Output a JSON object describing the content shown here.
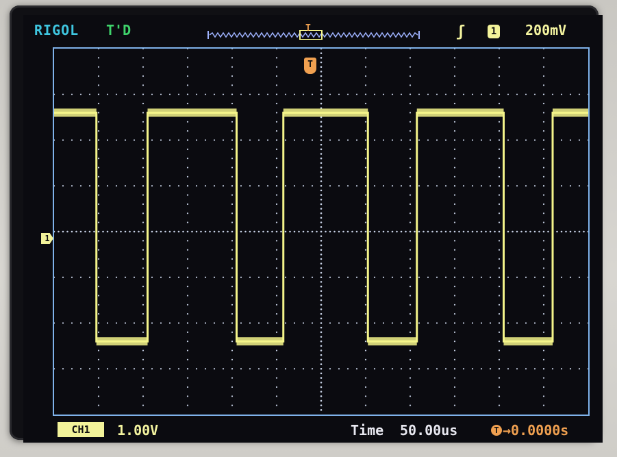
{
  "header": {
    "brand": "RIGOL",
    "trigger_status": "T'D",
    "trigger_marker": "T",
    "trigger_slope_icon": "rising-edge-icon",
    "trigger_source": "1",
    "trigger_level": "200mV"
  },
  "grid": {
    "h_div": 12,
    "v_div": 8
  },
  "waveform": {
    "color": "#f4f48a",
    "levels": {
      "high_div": 2.6,
      "low_div": -2.4
    },
    "transitions_div": [
      0.95,
      2.1,
      4.1,
      5.15,
      7.05,
      8.15,
      10.1,
      11.2
    ]
  },
  "markers": {
    "ch1_ground": "1",
    "trigger_position": "T"
  },
  "footer": {
    "ch1_label": "CH1",
    "ch1_scale": "1.00V",
    "time_label": "Time",
    "time_base": "50.00us",
    "offset_icon": "T",
    "offset": "→0.0000s"
  },
  "colors": {
    "brand": "#3fc6e0",
    "status": "#3fd36b",
    "trace": "#f4f48a",
    "grid_border": "#7fb2ea",
    "trigger": "#f0a050"
  }
}
